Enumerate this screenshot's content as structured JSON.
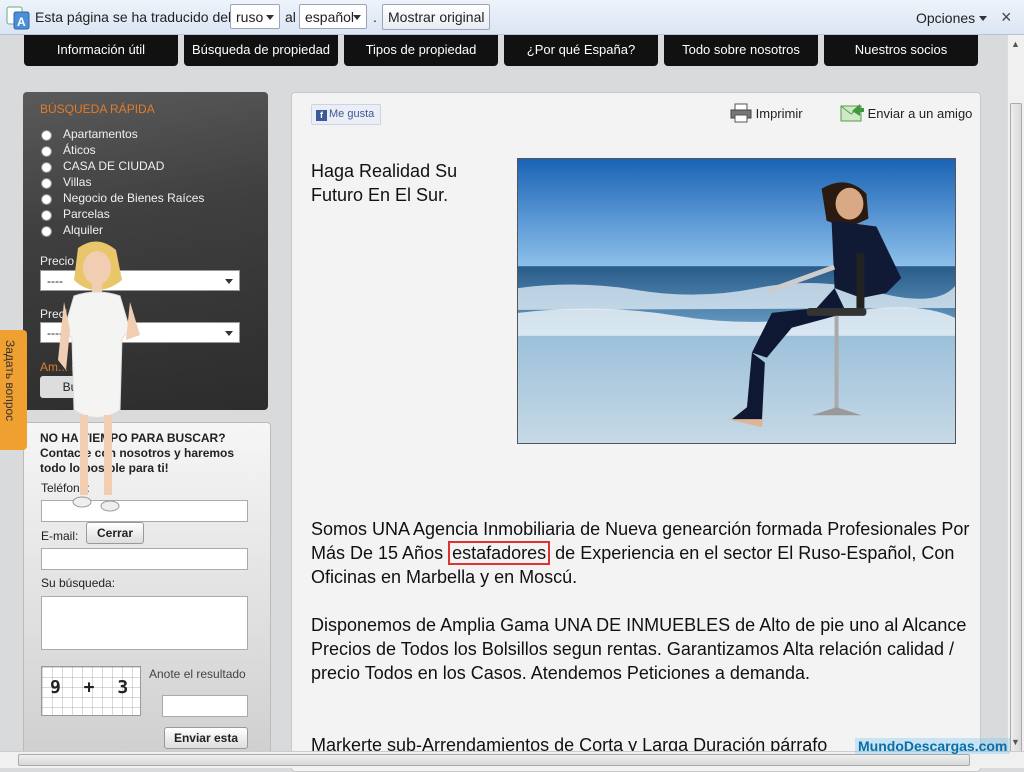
{
  "translate_bar": {
    "message": "Esta página se ha traducido del",
    "from_lang": "ruso",
    "to_word": "al",
    "to_lang": "español",
    "dot": ".",
    "show_original": "Mostrar original",
    "options": "Opciones",
    "close": "×"
  },
  "nav": [
    "Información útil",
    "Búsqueda de propiedad",
    "Tipos de propiedad",
    "¿Por qué España?",
    "Todo sobre nosotros",
    "Nuestros socios"
  ],
  "quick_search": {
    "title": "BÚSQUEDA RÁPIDA",
    "types": [
      "Apartamentos",
      "Áticos",
      "CASA DE CIUDAD",
      "Villas",
      "Negocio de Bienes Raíces",
      "Parcelas",
      "Alquiler"
    ],
    "price_from_label": "Precio de (€)",
    "price_from_value": "----",
    "price_to_label": "Preci",
    "price_to_value": "----",
    "advanced_link": "Am... squeda?",
    "search_button": "Bu"
  },
  "contact": {
    "message": "NO HA TIEMPO PARA BUSCAR? Contacte con nosotros y haremos todo lo posible para ti!",
    "phone_label": "Teléfono:",
    "close_button": "Cerrar",
    "email_label": "E-mail:",
    "search_label": "Su búsqueda:",
    "captcha": "9 + 3",
    "result_label": "Anote el resultado",
    "send_button": "Enviar esta"
  },
  "feedback_tab": "Задать вопрос",
  "main": {
    "like": "Me gusta",
    "print": "Imprimir",
    "send_friend": "Enviar a un amigo",
    "headline": "Haga Realidad Su Futuro En El Sur.",
    "p1_a": "Somos UNA Agencia Inmobiliaria de Nueva genearción formada Profesionales Por Más De 15 Años",
    "p1_highlight": "estafadores",
    "p1_b": "de Experiencia en el sector El Ruso-Español, Con Oficinas en Marbella y en Moscú.",
    "p2": "Disponemos de Amplia Gama UNA DE INMUEBLES de Alto de pie uno al Alcance Precios de Todos los Bolsillos segun rentas. Garantizamos Alta relación calidad / precio Todos en los Casos. Atendemos Peticiones a demanda.",
    "p3": "Markerte sub-Arrendamientos de Corta y Larga Duración párrafo"
  },
  "watermark": "MundoDescargas.com",
  "colors": {
    "accent": "#e07c2a",
    "nav_bg": "#111111",
    "highlight": "#dd3333"
  }
}
